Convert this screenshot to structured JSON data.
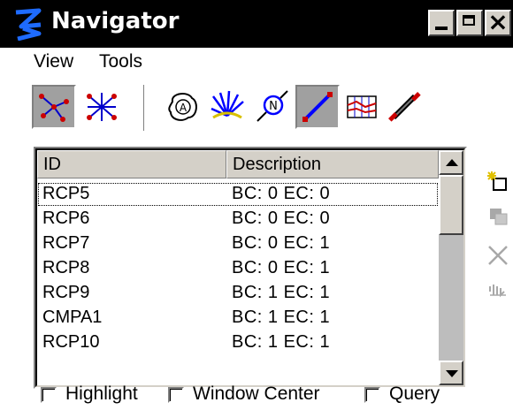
{
  "window": {
    "title": "Navigator",
    "colors": {
      "titlebar": "#000000",
      "face": "#d4d0c8",
      "accent_blue": "#0000ff"
    }
  },
  "menu": [
    "View",
    "Tools"
  ],
  "toolbar": {
    "view_group": [
      {
        "icon": "network-view-icon",
        "pressed": true
      },
      {
        "icon": "star-network-icon",
        "pressed": false
      }
    ],
    "element_group": [
      {
        "icon": "alignment-point-icon",
        "pressed": false
      },
      {
        "icon": "burst-lines-icon",
        "pressed": false
      },
      {
        "icon": "node-circle-icon",
        "pressed": false
      },
      {
        "icon": "segment-line-icon",
        "pressed": true
      },
      {
        "icon": "profile-grid-icon",
        "pressed": false
      },
      {
        "icon": "pipe-segment-icon",
        "pressed": false
      }
    ]
  },
  "list": {
    "columns": [
      "ID",
      "Description"
    ],
    "rows": [
      {
        "id": "RCP5",
        "description": "BC: 0 EC: 0"
      },
      {
        "id": "RCP6",
        "description": "BC: 0 EC: 0"
      },
      {
        "id": "RCP7",
        "description": "BC: 0 EC: 1"
      },
      {
        "id": "RCP8",
        "description": "BC: 0 EC: 1"
      },
      {
        "id": "RCP9",
        "description": "BC: 1 EC: 1"
      },
      {
        "id": "CMPA1",
        "description": "BC: 1 EC: 1"
      },
      {
        "id": "RCP10",
        "description": "BC: 1 EC: 1"
      }
    ]
  },
  "side_buttons": [
    {
      "icon": "new-item-icon",
      "enabled": true
    },
    {
      "icon": "copy-icon",
      "enabled": false
    },
    {
      "icon": "delete-icon",
      "enabled": false
    },
    {
      "icon": "review-icon",
      "enabled": false
    }
  ],
  "checkboxes": [
    {
      "label": "Highlight",
      "checked": false
    },
    {
      "label": "Window Center",
      "checked": false
    },
    {
      "label": "Query",
      "checked": false
    }
  ]
}
